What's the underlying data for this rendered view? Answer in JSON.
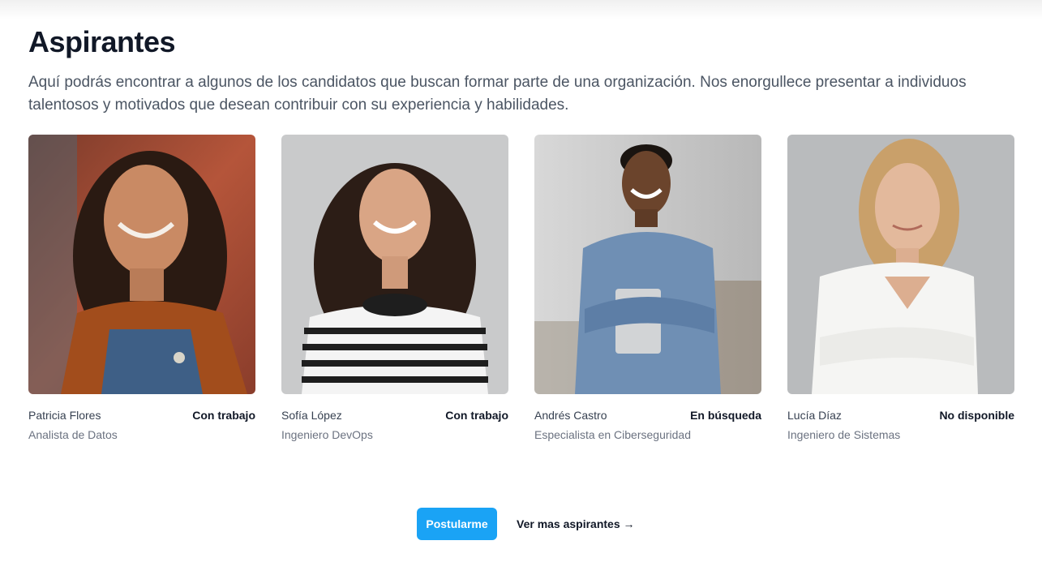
{
  "section": {
    "title": "Aspirantes",
    "intro": "Aquí podrás encontrar a algunos de los candidatos que buscan formar parte de una organización. Nos enorgullece presentar a individuos talentosos y motivados que desean contribuir con su experiencia y habilidades."
  },
  "candidates": [
    {
      "name": "Patricia Flores",
      "status": "Con trabajo",
      "role": "Analista de Datos"
    },
    {
      "name": "Sofía López",
      "status": "Con trabajo",
      "role": "Ingeniero DevOps"
    },
    {
      "name": "Andrés Castro",
      "status": "En búsqueda",
      "role": "Especialista en Ciberseguridad"
    },
    {
      "name": "Lucía Díaz",
      "status": "No disponible",
      "role": "Ingeniero de Sistemas"
    }
  ],
  "actions": {
    "apply_label": "Postularme",
    "more_label": "Ver mas aspirantes →"
  },
  "colors": {
    "accent": "#1aa3f5",
    "title": "#111827",
    "muted": "#6b7280"
  }
}
